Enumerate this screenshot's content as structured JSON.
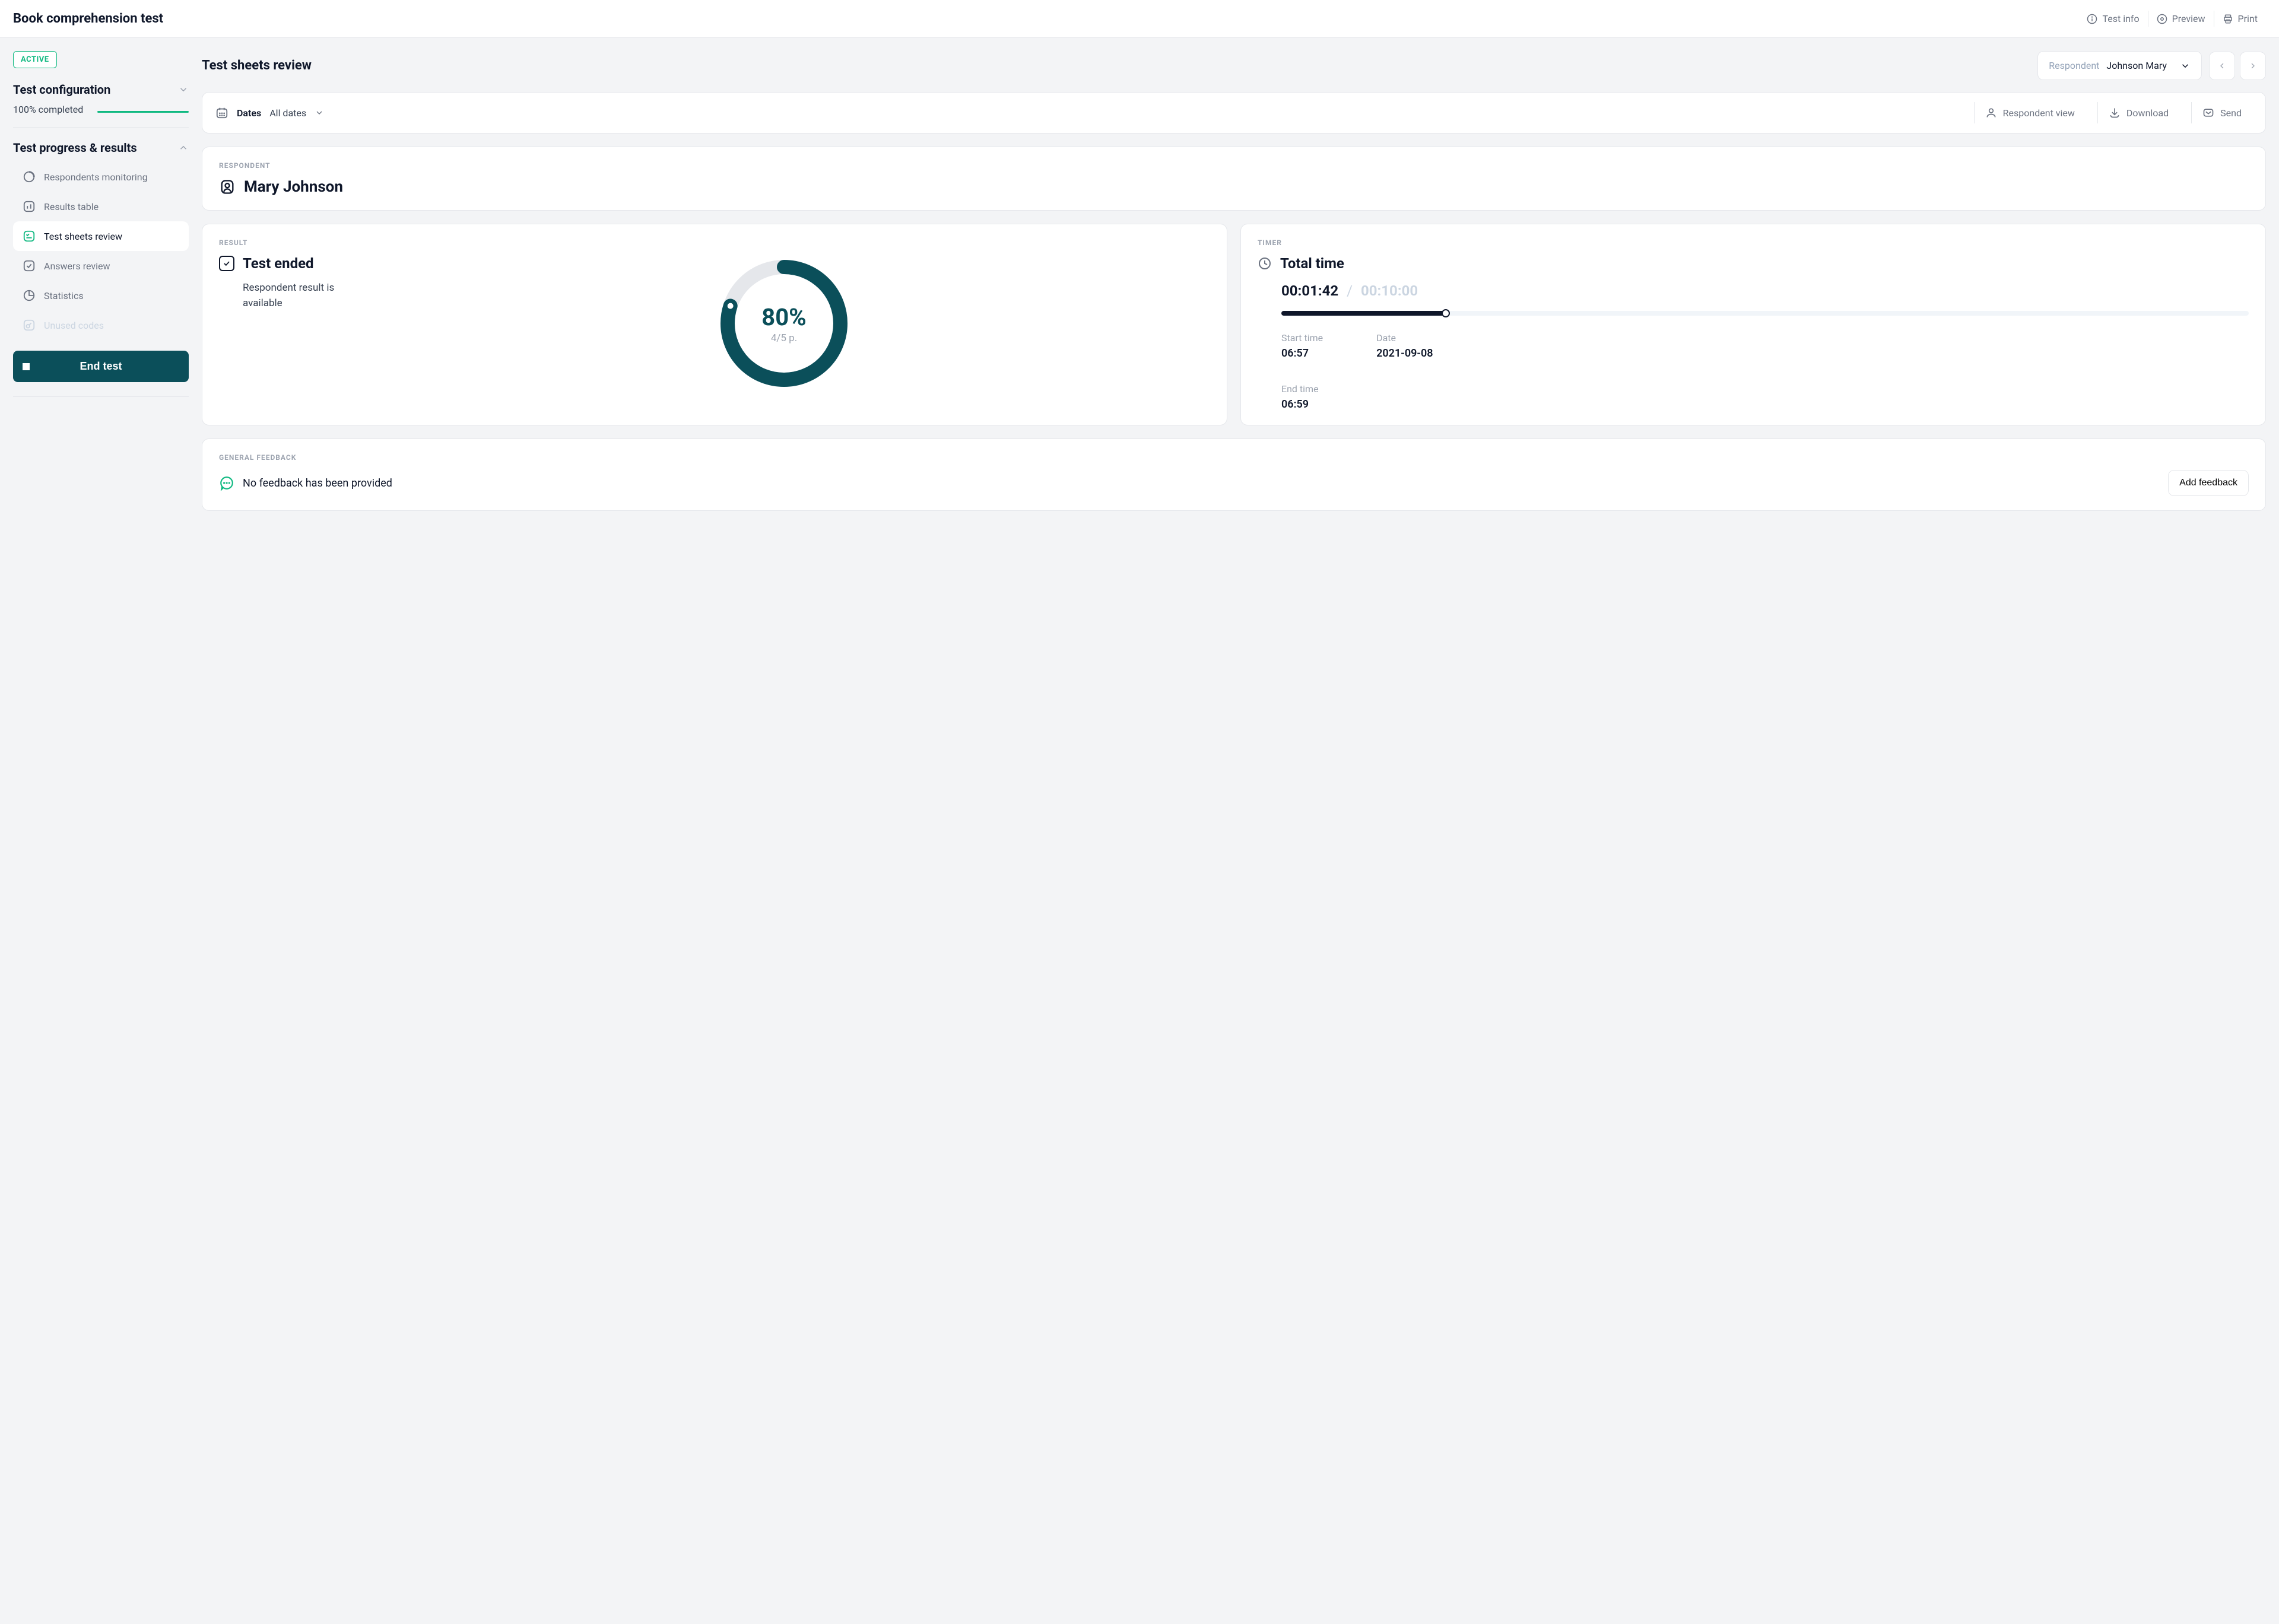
{
  "header": {
    "title": "Book comprehension test",
    "actions": {
      "test_info": "Test info",
      "preview": "Preview",
      "print": "Print"
    }
  },
  "sidebar": {
    "status_badge": "ACTIVE",
    "sections": {
      "config": {
        "title": "Test configuration",
        "completion": "100% completed"
      },
      "progress": {
        "title": "Test progress & results",
        "items": [
          {
            "label": "Respondents monitoring"
          },
          {
            "label": "Results table"
          },
          {
            "label": "Test sheets review"
          },
          {
            "label": "Answers review"
          },
          {
            "label": "Statistics"
          },
          {
            "label": "Unused codes"
          }
        ]
      }
    },
    "end_test": "End test"
  },
  "main": {
    "title": "Test sheets review",
    "respondent_picker": {
      "label": "Respondent",
      "value": "Johnson Mary"
    },
    "toolbar": {
      "dates_label": "Dates",
      "dates_value": "All dates",
      "respondent_view": "Respondent view",
      "download": "Download",
      "send": "Send"
    },
    "respondent_card": {
      "label": "RESPONDENT",
      "name": "Mary Johnson"
    },
    "result_card": {
      "label": "RESULT",
      "title": "Test ended",
      "subtitle": "Respondent result is available",
      "percent_text": "80%",
      "fraction_text": "4/5 p."
    },
    "timer_card": {
      "label": "TIMER",
      "title": "Total time",
      "elapsed": "00:01:42",
      "total": "00:10:00",
      "start_label": "Start time",
      "start_value": "06:57",
      "date_label": "Date",
      "date_value": "2021-09-08",
      "end_label": "End time",
      "end_value": "06:59"
    },
    "feedback_card": {
      "label": "GENERAL FEEDBACK",
      "text": "No feedback has been provided",
      "button": "Add feedback"
    }
  },
  "chart_data": {
    "type": "pie",
    "title": "Result",
    "values": [
      80,
      20
    ],
    "categories": [
      "score",
      "remaining"
    ],
    "percent": 80,
    "score": 4,
    "max_score": 5,
    "colors": {
      "score": "#0b4f5a",
      "remaining": "#e5e7eb"
    }
  },
  "timer_chart": {
    "type": "bar",
    "elapsed_seconds": 102,
    "total_seconds": 600,
    "percent": 17
  }
}
